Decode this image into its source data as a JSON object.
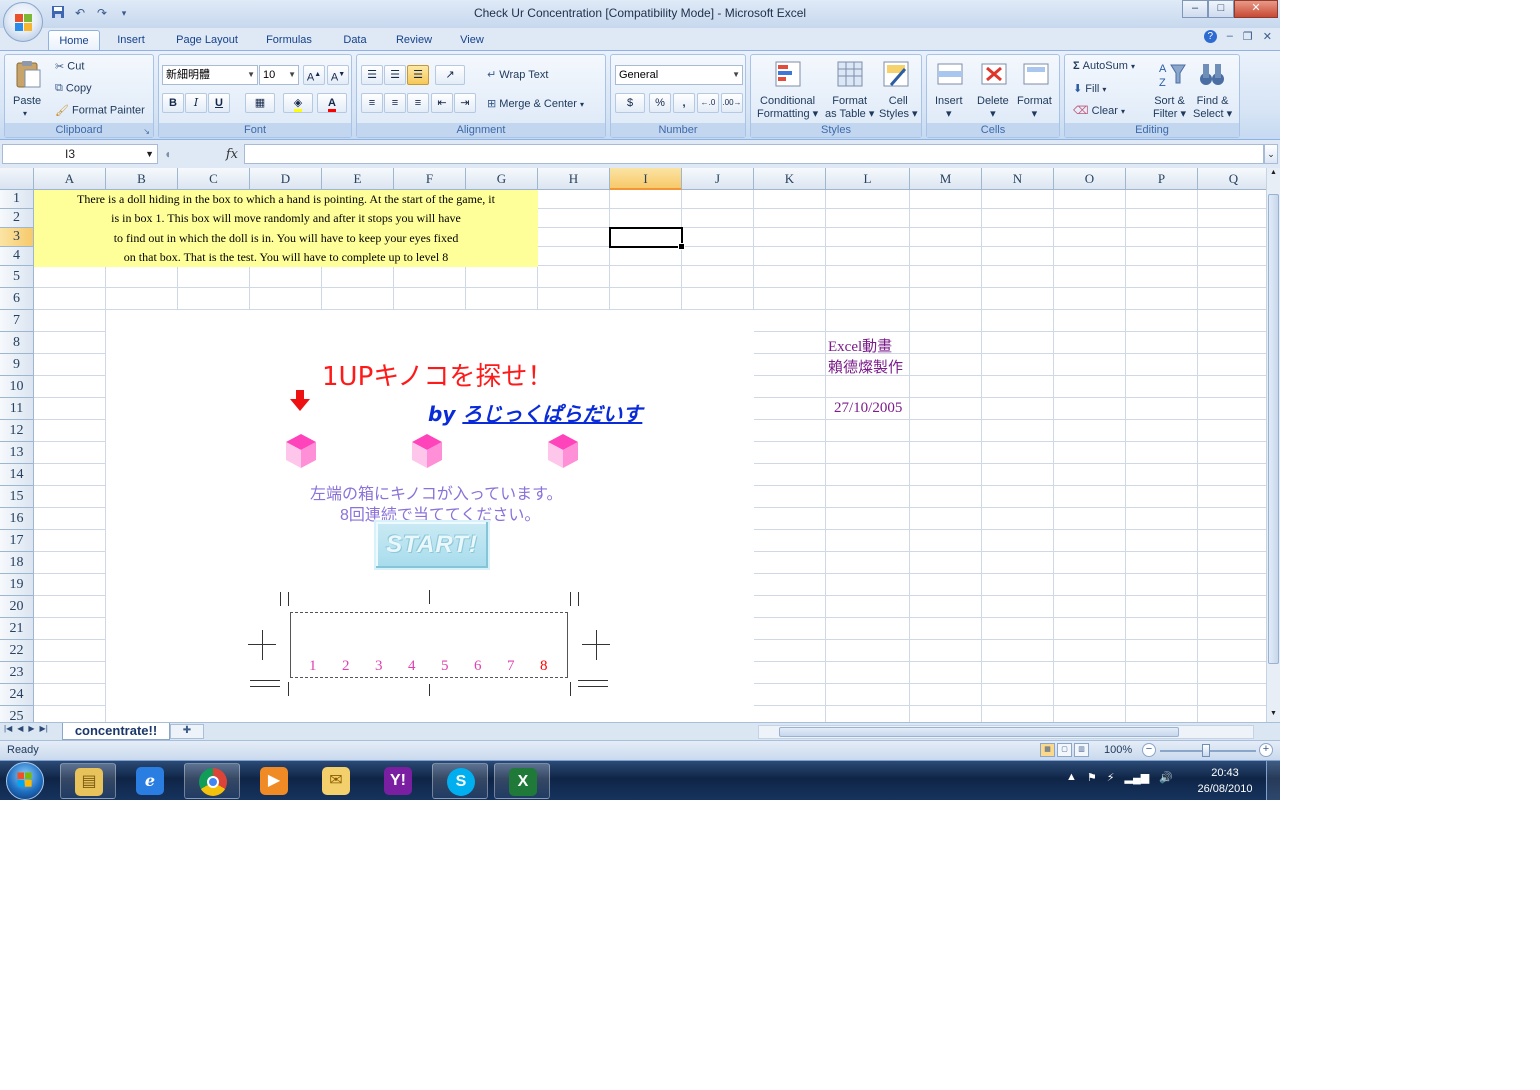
{
  "window": {
    "title": "Check Ur Concentration  [Compatibility Mode] - Microsoft Excel",
    "buttons": {
      "minimize": "–",
      "maximize": "□",
      "close": "✕"
    }
  },
  "ribbon_tabs": [
    "Home",
    "Insert",
    "Page Layout",
    "Formulas",
    "Data",
    "Review",
    "View"
  ],
  "ribbon": {
    "clipboard": {
      "label": "Clipboard",
      "paste": "Paste",
      "cut": "Cut",
      "copy": "Copy",
      "format_painter": "Format Painter"
    },
    "font": {
      "label": "Font",
      "name": "新細明體",
      "size": "10",
      "bold": "B",
      "italic": "I",
      "underline": "U"
    },
    "alignment": {
      "label": "Alignment",
      "wrap_text": "Wrap Text",
      "merge_center": "Merge & Center"
    },
    "number": {
      "label": "Number",
      "format": "General",
      "percent": "%",
      "comma": ",",
      "inc_dec": "+.0 .00",
      "dec_dec": ".00 +.0"
    },
    "styles": {
      "label": "Styles",
      "conditional": "Conditional",
      "conditional2": "Formatting",
      "format_table": "Format",
      "format_table2": "as Table",
      "cell_styles": "Cell",
      "cell_styles2": "Styles"
    },
    "cells": {
      "label": "Cells",
      "insert": "Insert",
      "delete": "Delete",
      "format": "Format"
    },
    "editing": {
      "label": "Editing",
      "autosum": "AutoSum",
      "fill": "Fill",
      "clear": "Clear",
      "sort_filter": "Sort &",
      "sort_filter2": "Filter",
      "find_select": "Find &",
      "find_select2": "Select"
    }
  },
  "formula_bar": {
    "name_box": "I3",
    "fx": "fx",
    "formula": ""
  },
  "columns": [
    "A",
    "B",
    "C",
    "D",
    "E",
    "F",
    "G",
    "H",
    "I",
    "J",
    "K",
    "L",
    "M",
    "N",
    "O",
    "P",
    "Q"
  ],
  "selected_column": "I",
  "rows": [
    "1",
    "2",
    "3",
    "4",
    "5",
    "6",
    "7",
    "8",
    "9",
    "10",
    "11",
    "12",
    "13",
    "14",
    "15",
    "16",
    "17",
    "18",
    "19",
    "20",
    "21",
    "22",
    "23",
    "24",
    "25"
  ],
  "selected_row": "3",
  "intro_text": [
    "There is a doll hiding in the box to which a hand is pointing. At the start of the game, it",
    "is in box 1. This box will move randomly and after it stops you will have",
    "to find out in which the doll is in. You will have to keep your eyes fixed",
    "on that box. That is the test. You will have to complete up to level 8"
  ],
  "game": {
    "title": "1UPキノコを探せ！",
    "by": "by",
    "author": "ろじっくぱらだいす",
    "instruction1": "左端の箱にキノコが入っています。",
    "instruction2": "8回連続で当ててください。",
    "start": "START!",
    "levels": [
      "1",
      "2",
      "3",
      "4",
      "5",
      "6",
      "7",
      "8"
    ]
  },
  "side": {
    "line1": "Excel動畫",
    "line2": "賴德燦製作",
    "date": "27/10/2005"
  },
  "sheet_tab": "concentrate!!",
  "status": {
    "ready": "Ready",
    "zoom": "100%",
    "zoom_level": 1.0
  },
  "taskbar": {
    "time": "20:43",
    "date": "26/08/2010"
  },
  "colors": {
    "intro_bg": "#ffff99",
    "title": "#ff1a1a",
    "author": "#0a2bd8",
    "instruction": "#8a72d9",
    "box": "#ff66cc",
    "side_text": "#7b1c8a"
  }
}
